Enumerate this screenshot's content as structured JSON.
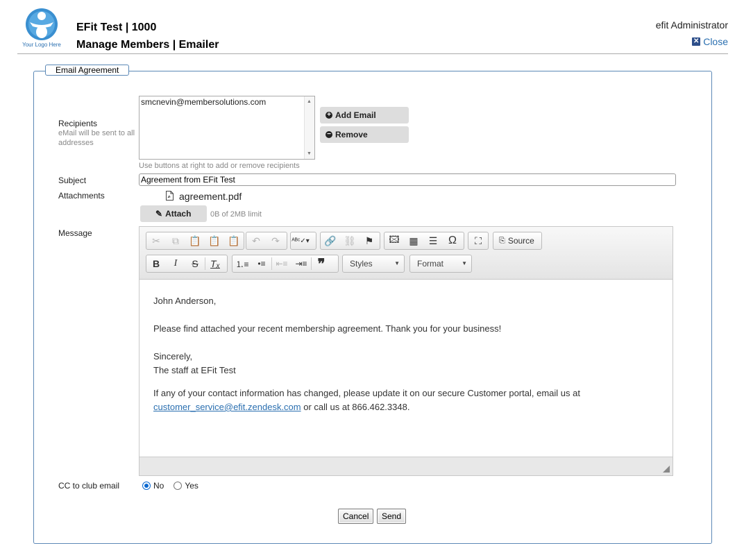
{
  "header": {
    "logo_text": "Your Logo Here",
    "title_line1": "EFit Test | 1000",
    "title_line2": "Manage Members | Emailer",
    "user": "efit Administrator",
    "close_label": "Close"
  },
  "form": {
    "legend": "Email Agreement",
    "recipients": {
      "label": "Recipients",
      "sublabel": "eMail will be sent to all addresses",
      "items": [
        "smcnevin@membersolutions.com"
      ],
      "hint": "Use buttons at right to add or remove recipients",
      "add_label": "Add Email",
      "remove_label": "Remove"
    },
    "subject": {
      "label": "Subject",
      "value": "Agreement from EFit Test"
    },
    "attachments": {
      "label": "Attachments",
      "file": "agreement.pdf",
      "attach_label": "Attach",
      "limit": "0B of 2MB limit"
    },
    "message": {
      "label": "Message",
      "styles_label": "Styles",
      "format_label": "Format",
      "source_label": "Source",
      "greeting": "John Anderson,",
      "body": "Please find attached your recent membership agreement. Thank you for your business!",
      "closing1": "Sincerely,",
      "closing2": "The staff at EFit Test",
      "footer_pre": "If any of your contact information has changed, please update it on our secure Customer portal, email us at",
      "footer_link": "customer_service@efit.zendesk.com",
      "footer_post": " or call us at 866.462.3348."
    },
    "cc": {
      "label": "CC to club email",
      "options": [
        "No",
        "Yes"
      ],
      "selected": "No"
    },
    "cancel_label": "Cancel",
    "send_label": "Send"
  },
  "colors": {
    "accent": "#2a6fb0",
    "border": "#5b88b6",
    "radio": "#0a68d0"
  }
}
